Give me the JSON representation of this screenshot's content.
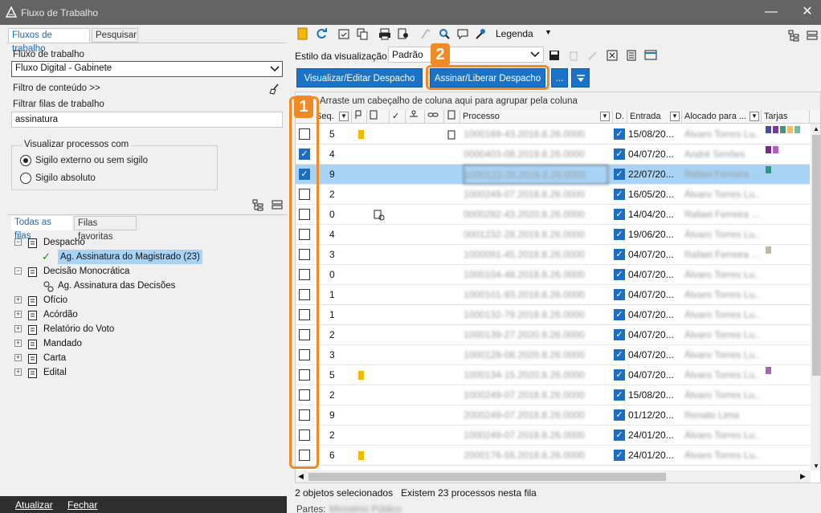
{
  "window": {
    "title": "Fluxo de Trabalho"
  },
  "left_tabs": [
    "Fluxos de trabalho",
    "Pesquisar"
  ],
  "workflow": {
    "label": "Fluxo de trabalho",
    "value": "Fluxo Digital - Gabinete",
    "content_filter": "Filtro de conteúdo >>",
    "queue_filter_label": "Filtrar filas de trabalho",
    "queue_filter_value": "assinatura"
  },
  "visibility": {
    "legend": "Visualizar processos com",
    "options": [
      "Sigilo externo ou sem sigilo",
      "Sigilo absoluto"
    ],
    "selected": 0
  },
  "queue_tabs": [
    "Todas as filas",
    "Filas favoritas"
  ],
  "tree": [
    {
      "label": "Despacho",
      "level": 0,
      "expander": "−"
    },
    {
      "label": "Ag. Assinatura do Magistrado (23)",
      "level": 1,
      "selected": true
    },
    {
      "label": "Decisão Monocrática",
      "level": 0,
      "expander": "−"
    },
    {
      "label": "Ag. Assinatura das Decisões",
      "level": 1
    },
    {
      "label": "Ofício",
      "level": 0,
      "expander": "+"
    },
    {
      "label": "Acórdão",
      "level": 0,
      "expander": "+"
    },
    {
      "label": "Relatório do Voto",
      "level": 0,
      "expander": "+"
    },
    {
      "label": "Mandado",
      "level": 0,
      "expander": "+"
    },
    {
      "label": "Carta",
      "level": 0,
      "expander": "+"
    },
    {
      "label": "Edital",
      "level": 0,
      "expander": "+"
    }
  ],
  "bottom": {
    "refresh": "Atualizar",
    "close": "Fechar"
  },
  "toolbar": {
    "legend": "Legenda",
    "view_style_label": "Estilo da visualização",
    "view_style_value": "Padrão"
  },
  "buttons": {
    "view_edit": "Visualizar/Editar Despacho",
    "sign": "Assinar/Liberar Despacho",
    "more": "..."
  },
  "badges": [
    "1",
    "2"
  ],
  "grid": {
    "group_hint": "Arraste um cabeçalho de coluna aqui para agrupar pela coluna",
    "columns": [
      "Seq.",
      "Processo",
      "D.",
      "Entrada",
      "Alocado para ...",
      "Tarjas"
    ],
    "rows": [
      {
        "checked": false,
        "seq": "5",
        "flag": true,
        "process": "1000169-43.2018.8.26.0000",
        "entrada": "15/08/20...",
        "alocado": "Álvaro Torres Lu...",
        "tags": [
          "#4a4aa8",
          "#7a3aa0",
          "#3a9a7a",
          "#f0c060",
          "#6ac0a0"
        ]
      },
      {
        "checked": true,
        "seq": "4",
        "flag": false,
        "process": "0000403-08.2019.8.26.0000",
        "entrada": "04/07/20...",
        "alocado": "André Simões",
        "tags": [
          "#7a2a8a",
          "#b060c0"
        ]
      },
      {
        "checked": true,
        "seq": "9",
        "flag": false,
        "process": "1000122-35.2018.8.26.0000",
        "entrada": "22/07/20...",
        "alocado": "Rafael Ferreira ...",
        "tags": [
          "#2a9a7a"
        ],
        "selected": true
      },
      {
        "checked": false,
        "seq": "2",
        "flag": false,
        "process": "1000249-07.2018.8.26.0000",
        "entrada": "16/05/20...",
        "alocado": "Álvaro Torres Lu...",
        "tags": []
      },
      {
        "checked": false,
        "seq": "0",
        "flag": false,
        "process": "0000282-43.2020.8.26.0000",
        "entrada": "14/04/20...",
        "alocado": "Rafael Ferreira ...",
        "tags": []
      },
      {
        "checked": false,
        "seq": "4",
        "flag": false,
        "process": "0001232-28.2019.8.26.0000",
        "entrada": "19/06/20...",
        "alocado": "Álvaro Torres Lu...",
        "tags": []
      },
      {
        "checked": false,
        "seq": "3",
        "flag": false,
        "process": "1000091-45.2018.8.26.0000",
        "entrada": "04/07/20...",
        "alocado": "Rafael Ferreira ...",
        "tags": [
          "#c0b8a0"
        ]
      },
      {
        "checked": false,
        "seq": "0",
        "flag": false,
        "process": "1000104-48.2018.8.26.0000",
        "entrada": "04/07/20...",
        "alocado": "Álvaro Torres Lu...",
        "tags": []
      },
      {
        "checked": false,
        "seq": "1",
        "flag": false,
        "process": "1000101-93.2018.8.26.0000",
        "entrada": "04/07/20...",
        "alocado": "Álvaro Torres Lu...",
        "tags": []
      },
      {
        "checked": false,
        "seq": "1",
        "flag": false,
        "process": "1000132-79.2018.8.26.0000",
        "entrada": "04/07/20...",
        "alocado": "Álvaro Torres Lu...",
        "tags": []
      },
      {
        "checked": false,
        "seq": "2",
        "flag": false,
        "process": "1000139-27.2020.8.26.0000",
        "entrada": "04/07/20...",
        "alocado": "Álvaro Torres Lu...",
        "tags": []
      },
      {
        "checked": false,
        "seq": "3",
        "flag": false,
        "process": "1000128-08.2020.8.26.0000",
        "entrada": "04/07/20...",
        "alocado": "Álvaro Torres Lu...",
        "tags": []
      },
      {
        "checked": false,
        "seq": "5",
        "flag": true,
        "process": "1000134-15.2020.8.26.0000",
        "entrada": "04/07/20...",
        "alocado": "Álvaro Torres Lu...",
        "tags": [
          "#b060c0"
        ]
      },
      {
        "checked": false,
        "seq": "2",
        "flag": false,
        "process": "1000249-07.2018.8.26.0000",
        "entrada": "15/08/20...",
        "alocado": "Álvaro Torres Lu...",
        "tags": []
      },
      {
        "checked": false,
        "seq": "9",
        "flag": false,
        "process": "2000249-07.2018.8.26.0000",
        "entrada": "01/12/20...",
        "alocado": "Renato Lima",
        "tags": []
      },
      {
        "checked": false,
        "seq": "2",
        "flag": false,
        "process": "1000249-07.2018.8.26.0000",
        "entrada": "24/01/20...",
        "alocado": "Álvaro Torres Lu...",
        "tags": []
      },
      {
        "checked": false,
        "seq": "6",
        "flag": true,
        "process": "2000176-55.2018.8.26.0000",
        "entrada": "24/01/20...",
        "alocado": "Álvaro Torres Lu...",
        "tags": []
      }
    ]
  },
  "status": {
    "selected": "2 objetos selecionados",
    "count": "Existem 23 processos nesta fila"
  },
  "parts": {
    "label": "Partes:",
    "value": "Ministério Público"
  },
  "colors": {
    "accent": "#1a73c6",
    "highlight": "#f08a24",
    "selection": "#a9d3f5",
    "flag": "#f5b800"
  }
}
